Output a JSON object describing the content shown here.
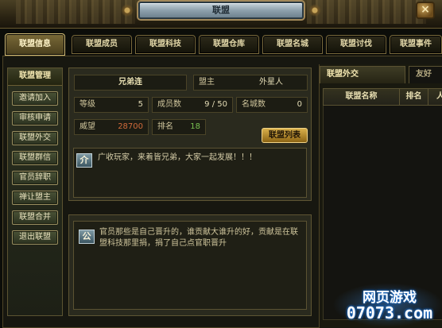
{
  "window": {
    "title": "联盟",
    "close_label": "×"
  },
  "tabs": [
    {
      "label": "联盟信息",
      "active": true
    },
    {
      "label": "联盟成员",
      "active": false
    },
    {
      "label": "联盟科技",
      "active": false
    },
    {
      "label": "联盟仓库",
      "active": false
    },
    {
      "label": "联盟名城",
      "active": false
    },
    {
      "label": "联盟讨伐",
      "active": false
    },
    {
      "label": "联盟事件",
      "active": false
    }
  ],
  "sidebar": {
    "title": "联盟管理",
    "items": [
      "邀请加入",
      "审核申请",
      "联盟外交",
      "联盟群信",
      "官员辞职",
      "禅让盟主",
      "联盟合并",
      "退出联盟"
    ]
  },
  "info": {
    "alliance_name": "兄弟连",
    "leader_label": "盟主",
    "leader_value": "外星人",
    "level_label": "等级",
    "level_value": "5",
    "members_label": "成员数",
    "members_value": "9 / 50",
    "cities_label": "名城数",
    "cities_value": "0",
    "prestige_label": "威望",
    "prestige_value": "28700",
    "rank_label": "排名",
    "rank_value": "18",
    "list_button": "联盟列表",
    "notice_badge": "介",
    "notice_text": "广收玩家，来着皆兄弟，大家一起发展！！！"
  },
  "announcement": {
    "badge": "公",
    "text": "官员那些是自己晋升的，谁贡献大谁升的好，贡献是在联盟科技那里捐，捐了自己点官职晋升"
  },
  "diplomacy": {
    "tab_active": "联盟外交",
    "tab_other": "友好",
    "col_name": "联盟名称",
    "col_rank": "排名",
    "col_extra": "人"
  },
  "watermark": {
    "cn": "网页游戏",
    "num": "07073.com"
  },
  "colors": {
    "accent_gold": "#d8c17a",
    "panel_bg": "#2a2a1e",
    "prestige_red": "#d06a3a",
    "rank_green": "#78c050"
  }
}
